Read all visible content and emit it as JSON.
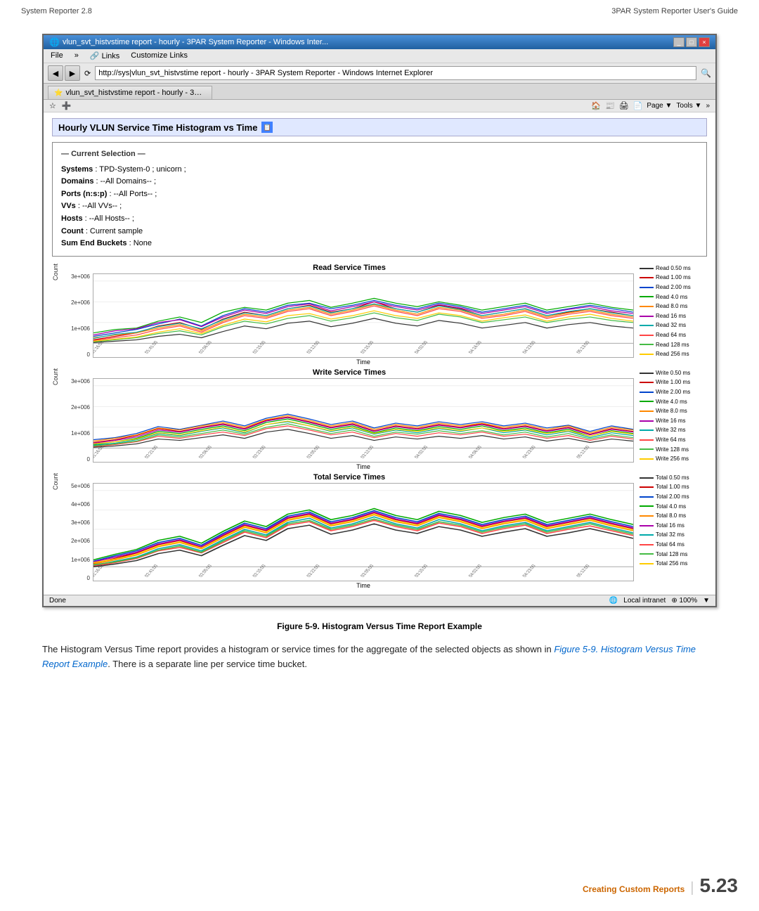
{
  "header": {
    "left": "System Reporter 2.8",
    "right": "3PAR System Reporter User's Guide"
  },
  "browser": {
    "titlebar": "vlun_svt_histvstime report - hourly - 3PAR System Reporter - Windows Inter...",
    "url": "http://sys|vlun_svt_histvstime report - hourly - 3PAR System Reporter - Windows Internet Explorer",
    "menu": [
      "File",
      "»",
      "Links",
      "Customize Links"
    ],
    "tab": "vlun_svt_histvstime report - hourly - 3PAR S...",
    "tab_toolbar_right": "Page ▼  Tools ▼  »",
    "page_title": "Hourly VLUN Service Time Histogram vs Time",
    "current_selection_title": "Current Selection",
    "selection_fields": [
      {
        "label": "Systems",
        "value": "TPD-System-0 ; unicorn ;"
      },
      {
        "label": "Domains",
        "value": "--All Domains-- ;"
      },
      {
        "label": "Ports (n:s:p)",
        "value": "--All Ports-- ;"
      },
      {
        "label": "VVs",
        "value": "--All VVs-- ;"
      },
      {
        "label": "Hosts",
        "value": "--All Hosts-- ;"
      },
      {
        "label": "Count",
        "value": "Current sample"
      },
      {
        "label": "Sum End Buckets",
        "value": "None"
      }
    ],
    "charts": [
      {
        "title": "Read Service Times",
        "y_label": "Count",
        "x_label": "Time",
        "y_axis": [
          "3e+006",
          "2e+006",
          "1e+006",
          "0"
        ],
        "legend": [
          {
            "label": "Read 0.50 ms",
            "color": "#333333"
          },
          {
            "label": "Read 1.00 ms",
            "color": "#cc0000"
          },
          {
            "label": "Read 2.00 ms",
            "color": "#0044cc"
          },
          {
            "label": "Read 4.0 ms",
            "color": "#00aa00"
          },
          {
            "label": "Read 8.0 ms",
            "color": "#ff8800"
          },
          {
            "label": "Read 16 ms",
            "color": "#aa00aa"
          },
          {
            "label": "Read 32 ms",
            "color": "#00aaaa"
          },
          {
            "label": "Read 64 ms",
            "color": "#ff4444"
          },
          {
            "label": "Read 128 ms",
            "color": "#44bb44"
          },
          {
            "label": "Read 256 ms",
            "color": "#ffcc00"
          }
        ]
      },
      {
        "title": "Write Service Times",
        "y_label": "Count",
        "x_label": "Time",
        "y_axis": [
          "3e+006",
          "2e+006",
          "1e+006",
          "0"
        ],
        "legend": [
          {
            "label": "Write 0.50 ms",
            "color": "#333333"
          },
          {
            "label": "Write 1.00 ms",
            "color": "#cc0000"
          },
          {
            "label": "Write 2.00 ms",
            "color": "#0044cc"
          },
          {
            "label": "Write 4.0 ms",
            "color": "#00aa00"
          },
          {
            "label": "Write 8.0 ms",
            "color": "#ff8800"
          },
          {
            "label": "Write 16 ms",
            "color": "#aa00aa"
          },
          {
            "label": "Write 32 ms",
            "color": "#00aaaa"
          },
          {
            "label": "Write 64 ms",
            "color": "#ff4444"
          },
          {
            "label": "Write 128 ms",
            "color": "#44bb44"
          },
          {
            "label": "Write 256 ms",
            "color": "#ffcc00"
          }
        ]
      },
      {
        "title": "Total Service Times",
        "y_label": "Count",
        "x_label": "Time",
        "y_axis": [
          "5e+006",
          "4e+006",
          "3e+006",
          "2e+006",
          "1e+006",
          "0"
        ],
        "legend": [
          {
            "label": "Total 0.50 ms",
            "color": "#333333"
          },
          {
            "label": "Total 1.00 ms",
            "color": "#cc0000"
          },
          {
            "label": "Total 2.00 ms",
            "color": "#0044cc"
          },
          {
            "label": "Total 4.0 ms",
            "color": "#00aa00"
          },
          {
            "label": "Total 8.0 ms",
            "color": "#ff8800"
          },
          {
            "label": "Total 16 ms",
            "color": "#aa00aa"
          },
          {
            "label": "Total 32 ms",
            "color": "#00aaaa"
          },
          {
            "label": "Total 64 ms",
            "color": "#ff4444"
          },
          {
            "label": "Total 128 ms",
            "color": "#44bb44"
          },
          {
            "label": "Total 256 ms",
            "color": "#ffcc00"
          }
        ]
      }
    ],
    "statusbar": {
      "left": "Done",
      "right_icon": "Local intranet",
      "zoom": "100%"
    }
  },
  "figure_caption": "Figure 5-9.  Histogram Versus Time Report Example",
  "body_paragraph": "The Histogram Versus Time report provides a histogram or service times for the aggregate of the selected objects as shown in ",
  "body_link": "Figure 5-9. Histogram Versus Time Report Example",
  "body_paragraph2": ". There is a separate line per service time bucket.",
  "footer": {
    "section": "Creating Custom Reports",
    "page": "5.23"
  }
}
